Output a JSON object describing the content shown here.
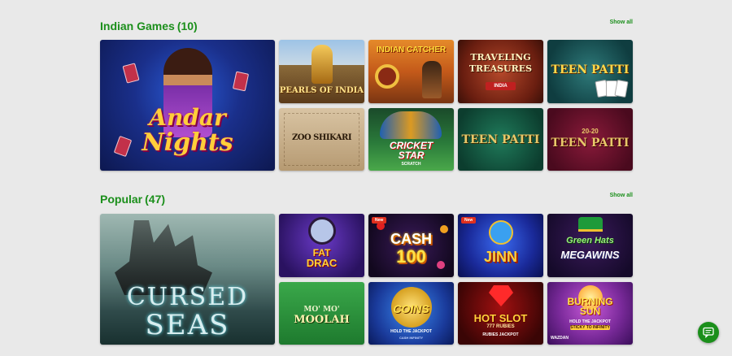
{
  "sections": {
    "indian": {
      "title": "Indian Games",
      "count": "(10)",
      "show_all": "Show all",
      "games": {
        "andar": [
          "Andar",
          "Nights"
        ],
        "pearls": "PEARLS OF INDIA",
        "catcher": "INDIAN CATCHER",
        "traveling": [
          "TRAVELING",
          "TREASURES"
        ],
        "traveling_sub": "INDIA",
        "teen_patti_1": "TEEN PATTI",
        "zoo": "ZOO SHIKARI",
        "cricket": [
          "CRICKET",
          "STAR"
        ],
        "cricket_sub": "SCRATCH",
        "teen_patti_2": "TEEN PATTI",
        "teen_patti_3_pre": "20-20",
        "teen_patti_3": "TEEN PATTI"
      }
    },
    "popular": {
      "title": "Popular",
      "count": "(47)",
      "show_all": "Show all",
      "games": {
        "cursed": [
          "CURSED",
          "SEAS"
        ],
        "fat_drac": [
          "FAT",
          "DRAC"
        ],
        "cash": [
          "CASH",
          "100"
        ],
        "cash_badge": "New",
        "jinn": "JINN",
        "jinn_badge": "New",
        "green_hats": [
          "Green Hats",
          "MEGAWINS"
        ],
        "moolah": [
          "MO' MO'",
          "MOOLAH"
        ],
        "coins": "COINS",
        "coins_sub": "HOLD THE JACKPOT",
        "coins_sub2": "CASH INFINITY",
        "hot_slot": "HOT SLOT",
        "hot_slot_sub": "777 RUBIES",
        "hot_slot_sub2": "RUBIES JACKPOT",
        "burning": [
          "BURNING",
          "SUN"
        ],
        "burning_sub": "HOLD THE JACKPOT",
        "burning_sub2": "STICKY TO INFINITY",
        "burning_brand": "WAZDAN"
      }
    }
  },
  "colors": {
    "accent": "#1b8f1b",
    "background": "#e9e9e9"
  },
  "icons": {
    "chat": "chat-bubble-icon"
  }
}
